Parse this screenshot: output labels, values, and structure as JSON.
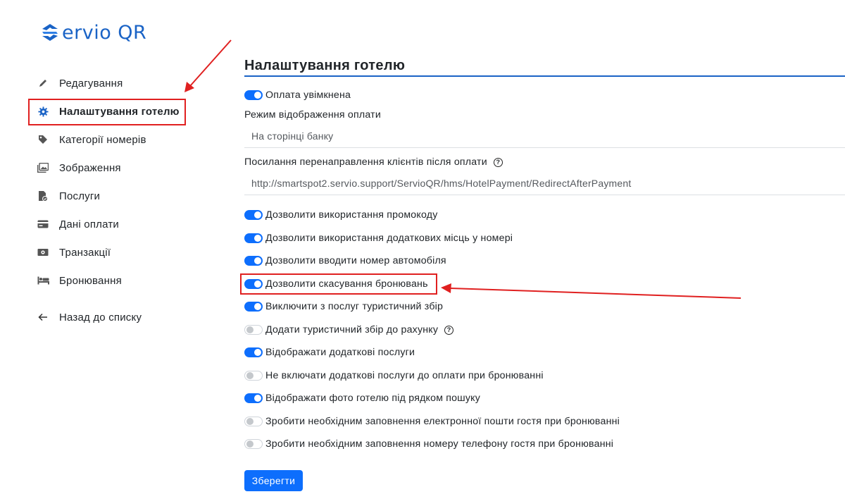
{
  "logo": {
    "text": "ervio QR"
  },
  "sidebar": {
    "items": [
      {
        "label": "Редагування",
        "icon": "pencil-icon"
      },
      {
        "label": "Налаштування готелю",
        "icon": "gear-icon",
        "active": true
      },
      {
        "label": "Категорії номерів",
        "icon": "tag-icon"
      },
      {
        "label": "Зображення",
        "icon": "images-icon"
      },
      {
        "label": "Послуги",
        "icon": "file-check-icon"
      },
      {
        "label": "Дані оплати",
        "icon": "credit-card-icon"
      },
      {
        "label": "Транзакції",
        "icon": "money-icon"
      },
      {
        "label": "Бронювання",
        "icon": "bed-icon"
      }
    ],
    "back": {
      "label": "Назад до списку",
      "icon": "arrow-left-icon"
    }
  },
  "main": {
    "title": "Налаштування готелю",
    "payment_enabled": {
      "label": "Оплата увімкнена",
      "on": true
    },
    "payment_display_mode": {
      "label": "Режим відображення оплати",
      "value": "На сторінці банку"
    },
    "redirect_url": {
      "label": "Посилання перенаправлення клієнтів після оплати",
      "help": "?",
      "value": "http://smartspot2.servio.support/ServioQR/hms/HotelPayment/RedirectAfterPayment"
    },
    "toggles": [
      {
        "label": "Дозволити використання промокоду",
        "on": true
      },
      {
        "label": "Дозволити використання додаткових місць у номері",
        "on": true
      },
      {
        "label": "Дозволити вводити номер автомобіля",
        "on": true
      },
      {
        "label": "Дозволити скасування бронювань",
        "on": true
      },
      {
        "label": "Виключити з послуг туристичний збір",
        "on": true
      },
      {
        "label": "Додати туристичний збір до рахунку",
        "on": false,
        "help": "?"
      },
      {
        "label": "Відображати додаткові послуги",
        "on": true
      },
      {
        "label": "Не включати додаткові послуги до оплати при бронюванні",
        "on": false
      },
      {
        "label": "Відображати фото готелю під рядком пошуку",
        "on": true
      },
      {
        "label": "Зробити необхідним заповнення електронної пошти гостя при бронюванні",
        "on": false
      },
      {
        "label": "Зробити необхідним заповнення номеру телефону гостя при бронюванні",
        "on": false
      }
    ],
    "save_label": "Зберегти"
  },
  "colors": {
    "primary": "#0d6efd",
    "brand": "#1a63c6",
    "annotation": "#e02020"
  }
}
